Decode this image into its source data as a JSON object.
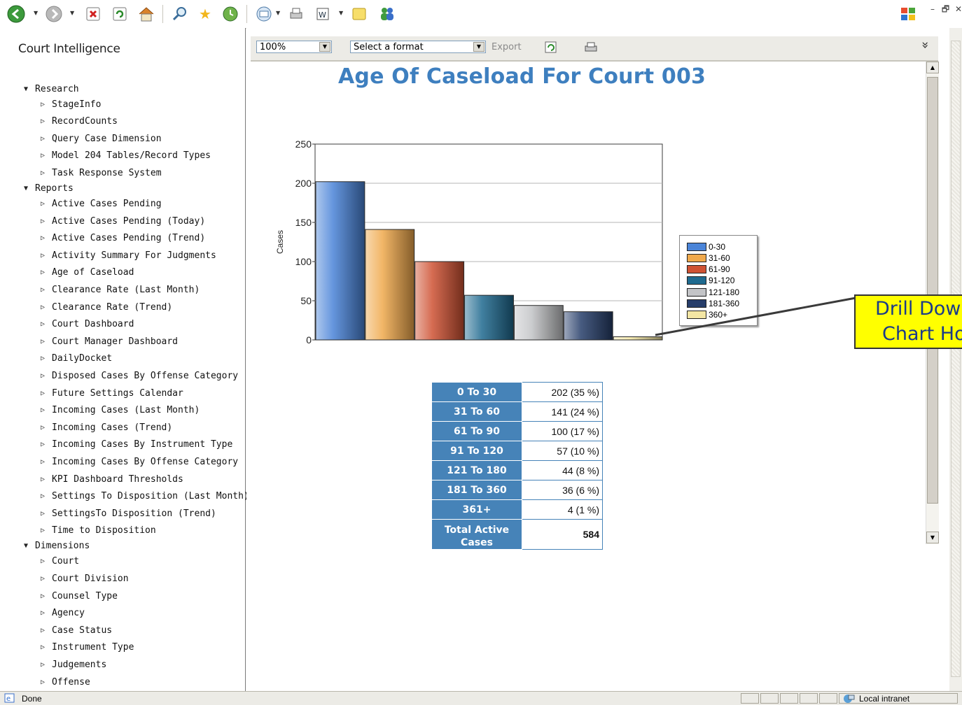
{
  "toolbar": {
    "icons": [
      "back-icon",
      "forward-icon",
      "stop-icon",
      "refresh-icon",
      "home-icon",
      "search-icon",
      "favorites-icon",
      "history-icon",
      "mail-icon",
      "print-icon",
      "edit-icon",
      "discuss-icon",
      "messenger-icon"
    ]
  },
  "window_controls": {
    "minimize": "–",
    "restore": "🗗",
    "close": "✕"
  },
  "sidebar": {
    "app_title": "Court Intelligence",
    "sections": [
      {
        "label": "Research",
        "items": [
          "StageInfo",
          "RecordCounts",
          "Query Case Dimension",
          "Model 204 Tables/Record Types",
          "Task Response System"
        ]
      },
      {
        "label": "Reports",
        "items": [
          "Active Cases Pending",
          "Active Cases Pending (Today)",
          "Active Cases Pending (Trend)",
          "Activity Summary For Judgments",
          "Age of Caseload",
          "Clearance Rate (Last Month)",
          "Clearance Rate (Trend)",
          "Court Dashboard",
          "Court Manager Dashboard",
          "DailyDocket",
          "Disposed Cases By Offense Category",
          "Future Settings Calendar",
          "Incoming Cases (Last Month)",
          "Incoming Cases (Trend)",
          "Incoming Cases By Instrument Type",
          "Incoming Cases By Offense Category",
          "KPI Dashboard Thresholds",
          "Settings To Disposition (Last Month)",
          "SettingsTo Disposition (Trend)",
          "Time to Disposition"
        ]
      },
      {
        "label": "Dimensions",
        "items": [
          "Court",
          "Court Division",
          "Counsel Type",
          "Agency",
          "Case Status",
          "Instrument Type",
          "Judgements",
          "Offense"
        ]
      }
    ]
  },
  "report_toolbar": {
    "zoom": "100%",
    "format_placeholder": "Select a format",
    "export_label": "Export",
    "collapse_glyph": "»"
  },
  "report": {
    "title": "Age Of Caseload For Court 003",
    "table": [
      {
        "label": "0 To 30",
        "value": "202 (35 %)"
      },
      {
        "label": "31 To 60",
        "value": "141 (24 %)"
      },
      {
        "label": "61 To 90",
        "value": "100 (17 %)"
      },
      {
        "label": "91 To 120",
        "value": "57 (10 %)"
      },
      {
        "label": "121 To 180",
        "value": "44 (8 %)"
      },
      {
        "label": "181 To 360",
        "value": "36 (6 %)"
      },
      {
        "label": "361+",
        "value": "4 (1 %)"
      }
    ],
    "total": {
      "label": "Total Active Cases",
      "value": "584"
    }
  },
  "chart_data": {
    "type": "bar",
    "categories": [
      "0-30",
      "31-60",
      "61-90",
      "91-120",
      "121-180",
      "181-360",
      "360+"
    ],
    "values": [
      202,
      141,
      100,
      57,
      44,
      36,
      4
    ],
    "colors": [
      "#4a84d8",
      "#f0a94c",
      "#cf5233",
      "#1f6a8f",
      "#c3c4c7",
      "#273e6a",
      "#f3e6a4"
    ],
    "ylabel": "Cases",
    "ylim": [
      0,
      250
    ],
    "yticks": [
      0,
      50,
      100,
      150,
      200,
      250
    ],
    "grid": true,
    "legend_position": "right"
  },
  "callout": {
    "line1": "Drill Dow",
    "line2": "Chart Ho"
  },
  "statusbar": {
    "status": "Done",
    "zone": "Local intranet"
  }
}
